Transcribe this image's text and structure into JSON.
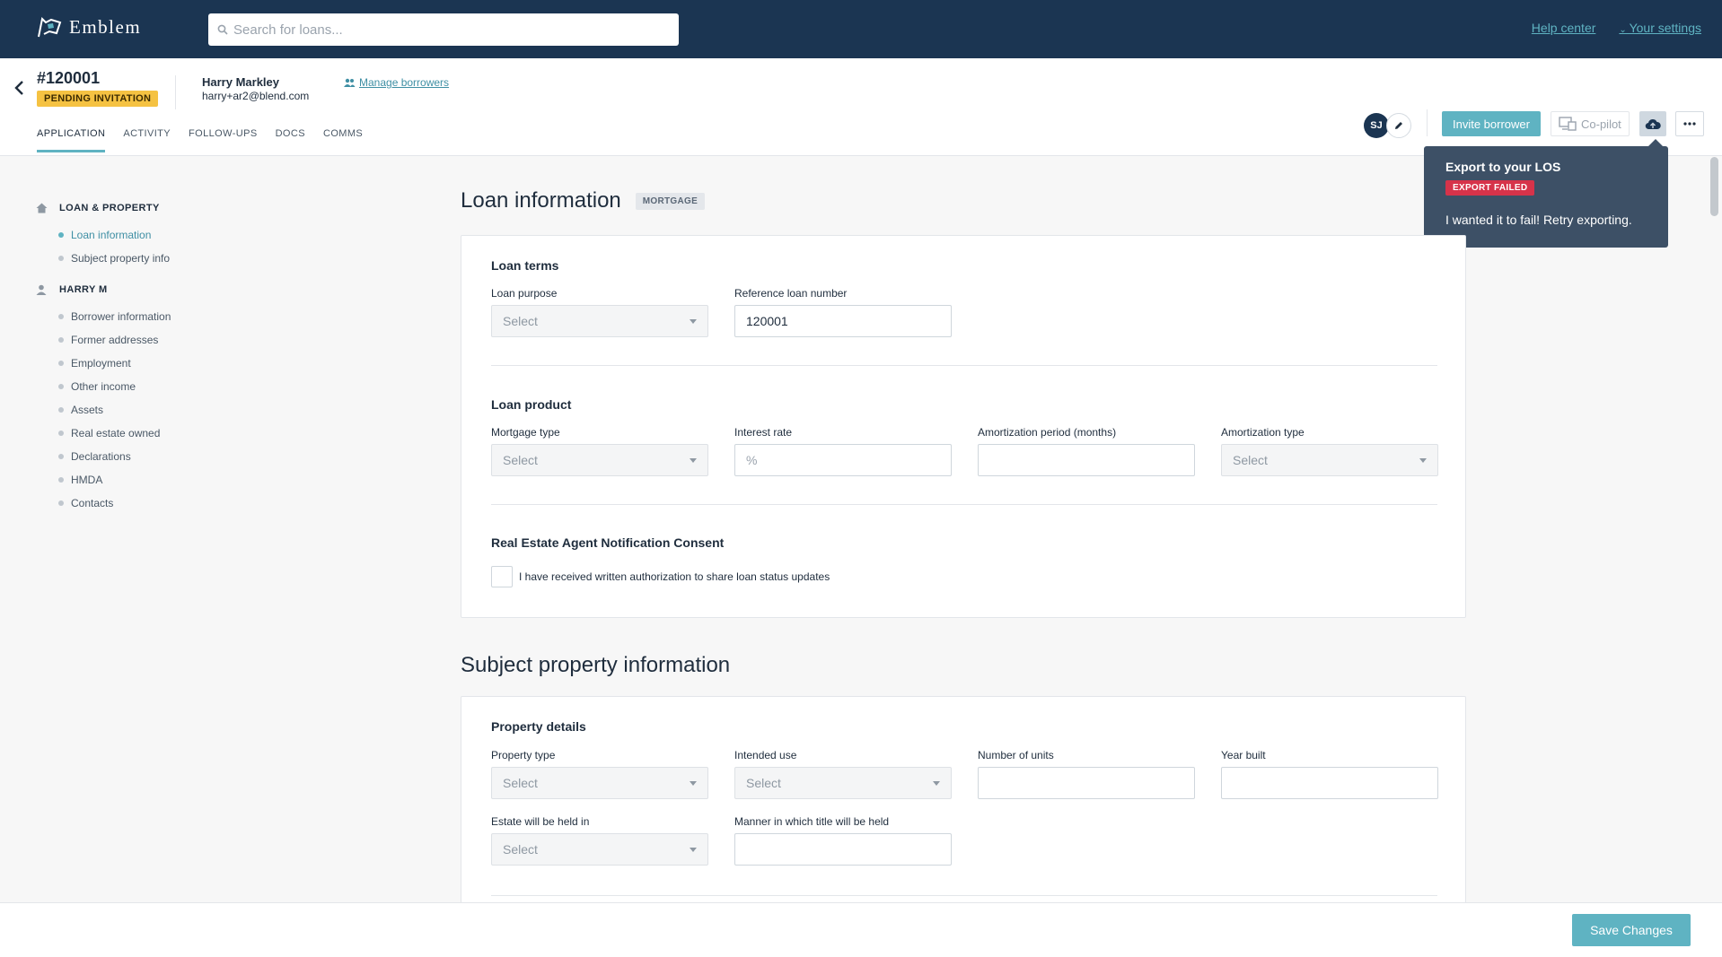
{
  "topbar": {
    "brand": "Emblem",
    "search_placeholder": "Search for loans...",
    "help_link": "Help center",
    "settings_link": "Your settings"
  },
  "header": {
    "loan_id": "#120001",
    "status_badge": "PENDING INVITATION",
    "borrower_name": "Harry Markley",
    "borrower_email": "harry+ar2@blend.com",
    "manage_borrowers": "Manage borrowers",
    "tabs": [
      {
        "label": "APPLICATION",
        "active": true
      },
      {
        "label": "ACTIVITY",
        "active": false
      },
      {
        "label": "FOLLOW-UPS",
        "active": false
      },
      {
        "label": "DOCS",
        "active": false
      },
      {
        "label": "COMMS",
        "active": false
      }
    ],
    "avatar_initials": "SJ",
    "invite_button": "Invite borrower",
    "copilot_button": "Co-pilot"
  },
  "export_popover": {
    "title": "Export to your LOS",
    "badge": "EXPORT FAILED",
    "message": "I wanted it to fail! Retry exporting."
  },
  "sidenav": {
    "sections": [
      {
        "title": "LOAN & PROPERTY",
        "icon": "home-icon",
        "items": [
          {
            "label": "Loan information",
            "active": true
          },
          {
            "label": "Subject property info",
            "active": false
          }
        ]
      },
      {
        "title": "HARRY M",
        "icon": "person-icon",
        "items": [
          {
            "label": "Borrower information"
          },
          {
            "label": "Former addresses"
          },
          {
            "label": "Employment"
          },
          {
            "label": "Other income"
          },
          {
            "label": "Assets"
          },
          {
            "label": "Real estate owned"
          },
          {
            "label": "Declarations"
          },
          {
            "label": "HMDA"
          },
          {
            "label": "Contacts"
          }
        ]
      }
    ]
  },
  "loan_info": {
    "title": "Loan information",
    "tag": "MORTGAGE",
    "loan_terms": {
      "heading": "Loan terms",
      "loan_purpose_label": "Loan purpose",
      "loan_purpose_value": "Select",
      "ref_number_label": "Reference loan number",
      "ref_number_value": "120001"
    },
    "loan_product": {
      "heading": "Loan product",
      "mortgage_type_label": "Mortgage type",
      "mortgage_type_value": "Select",
      "interest_rate_label": "Interest rate",
      "interest_rate_placeholder": "%",
      "amort_period_label": "Amortization period (months)",
      "amort_period_value": "",
      "amort_type_label": "Amortization type",
      "amort_type_value": "Select"
    },
    "consent": {
      "heading": "Real Estate Agent Notification Consent",
      "checkbox_label": "I have received written authorization to share loan status updates"
    }
  },
  "subject_property": {
    "title": "Subject property information",
    "property_details": {
      "heading": "Property details",
      "property_type_label": "Property type",
      "property_type_value": "Select",
      "intended_use_label": "Intended use",
      "intended_use_value": "Select",
      "units_label": "Number of units",
      "units_value": "",
      "year_built_label": "Year built",
      "year_built_value": "",
      "estate_label": "Estate will be held in",
      "estate_value": "Select",
      "title_manner_label": "Manner in which title will be held",
      "title_manner_value": ""
    }
  },
  "footer": {
    "save_button": "Save Changes"
  },
  "colors": {
    "navy": "#1b3552",
    "accent": "#5fb3c2",
    "pending": "#f5c242",
    "error": "#d6334a"
  }
}
